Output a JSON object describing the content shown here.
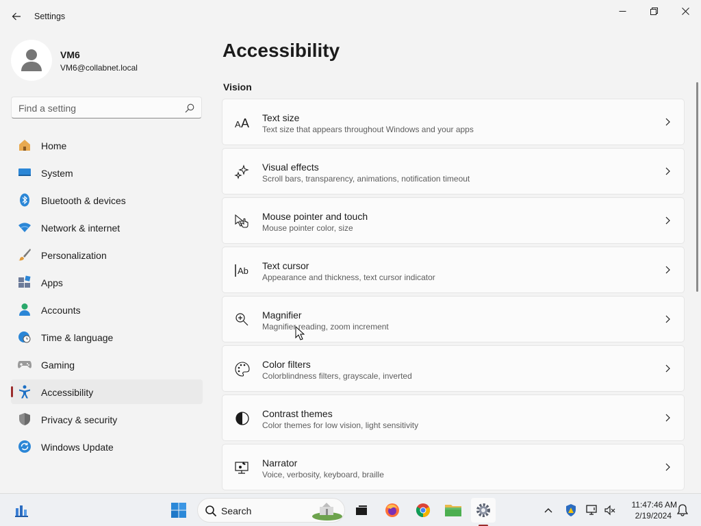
{
  "window": {
    "app_title": "Settings",
    "back_icon": "back-arrow-icon",
    "minimize_icon": "minimize-icon",
    "maximize_icon": "restore-icon",
    "close_icon": "close-icon"
  },
  "profile": {
    "name": "VM6",
    "email": "VM6@collabnet.local"
  },
  "search": {
    "placeholder": "Find a setting",
    "value": ""
  },
  "sidebar": {
    "items": [
      {
        "label": "Home",
        "icon": "home-icon",
        "color": "#d08b3c"
      },
      {
        "label": "System",
        "icon": "monitor-icon",
        "color": "#2b86d6"
      },
      {
        "label": "Bluetooth & devices",
        "icon": "bluetooth-icon",
        "color": "#2b86d6"
      },
      {
        "label": "Network & internet",
        "icon": "wifi-icon",
        "color": "#2b86d6"
      },
      {
        "label": "Personalization",
        "icon": "paintbrush-icon",
        "color": "#d07a2c"
      },
      {
        "label": "Apps",
        "icon": "apps-icon",
        "color": "#6b7a99"
      },
      {
        "label": "Accounts",
        "icon": "person-icon",
        "color": "#2aa86b"
      },
      {
        "label": "Time & language",
        "icon": "globe-clock-icon",
        "color": "#2b86d6"
      },
      {
        "label": "Gaming",
        "icon": "gamepad-icon",
        "color": "#8a8a8a"
      },
      {
        "label": "Accessibility",
        "icon": "accessibility-icon",
        "color": "#1c6fc4",
        "active": true
      },
      {
        "label": "Privacy & security",
        "icon": "shield-icon",
        "color": "#8a8a8a"
      },
      {
        "label": "Windows Update",
        "icon": "update-icon",
        "color": "#2b86d6"
      }
    ]
  },
  "main": {
    "title": "Accessibility",
    "section": "Vision",
    "cards": [
      {
        "title": "Text size",
        "desc": "Text size that appears throughout Windows and your apps",
        "icon": "text-size-icon"
      },
      {
        "title": "Visual effects",
        "desc": "Scroll bars, transparency, animations, notification timeout",
        "icon": "sparkle-icon"
      },
      {
        "title": "Mouse pointer and touch",
        "desc": "Mouse pointer color, size",
        "icon": "pointer-touch-icon"
      },
      {
        "title": "Text cursor",
        "desc": "Appearance and thickness, text cursor indicator",
        "icon": "text-cursor-icon"
      },
      {
        "title": "Magnifier",
        "desc": "Magnifier reading, zoom increment",
        "icon": "magnifier-icon"
      },
      {
        "title": "Color filters",
        "desc": "Colorblindness filters, grayscale, inverted",
        "icon": "palette-icon"
      },
      {
        "title": "Contrast themes",
        "desc": "Color themes for low vision, light sensitivity",
        "icon": "contrast-icon"
      },
      {
        "title": "Narrator",
        "desc": "Voice, verbosity, keyboard, braille",
        "icon": "narrator-icon"
      }
    ]
  },
  "taskbar": {
    "search_label": "Search",
    "time": "11:47:46 AM",
    "date": "2/19/2024",
    "accent": "#9b2c2c"
  }
}
